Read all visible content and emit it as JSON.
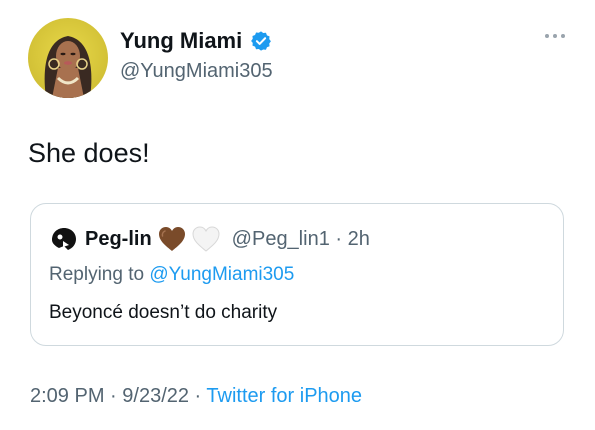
{
  "author": {
    "display_name": "Yung Miami",
    "handle": "@YungMiami305",
    "avatar_icon": "profile-photo",
    "verified_icon": "verified-badge-icon",
    "verified_color": "#1d9bf0"
  },
  "tweet": {
    "text": "She does!"
  },
  "quoted_tweet": {
    "display_name": "Peg-lin",
    "emoji_1": "brown-heart-icon",
    "emoji_2": "white-heart-icon",
    "handle_time": "@Peg_lin1 · 2h",
    "replying_prefix": "Replying to ",
    "replying_mention": "@YungMiami305",
    "text": "Beyoncé doesn’t do charity"
  },
  "meta": {
    "time": "2:09 PM",
    "sep1": " · ",
    "date": "9/23/22",
    "sep2": " · ",
    "source": "Twitter for iPhone"
  },
  "colors": {
    "link": "#1d9bf0",
    "secondary_text": "#536471",
    "border": "#cfd9de"
  }
}
